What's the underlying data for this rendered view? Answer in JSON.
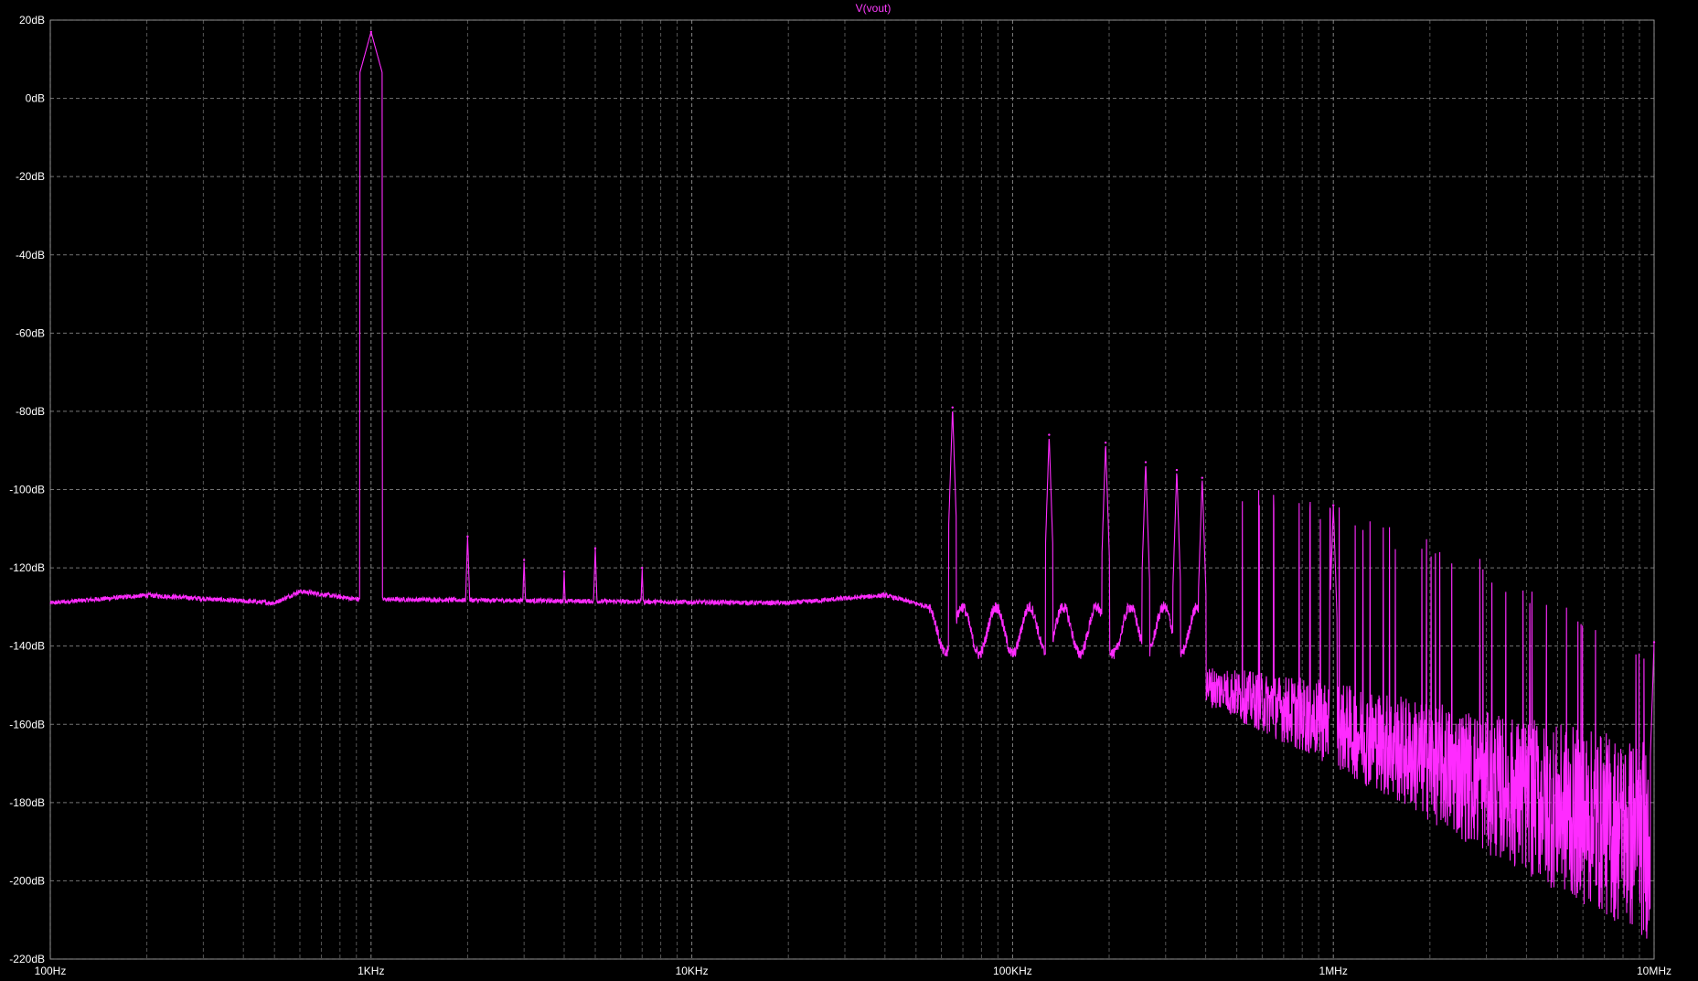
{
  "window": {
    "trace_label": "V(vout)"
  },
  "colors": {
    "background": "#000000",
    "trace": "#ff2bff",
    "grid": "#9a9a9a",
    "text": "#ffffff"
  },
  "chart_data": {
    "type": "line",
    "title": "V(vout)",
    "xlabel": "",
    "ylabel": "",
    "x_scale": "log",
    "xlim": [
      100,
      10000000
    ],
    "ylim": [
      -220,
      20
    ],
    "grid": true,
    "x_ticks": [
      {
        "value": 100,
        "label": "100Hz"
      },
      {
        "value": 1000,
        "label": "1KHz"
      },
      {
        "value": 10000,
        "label": "10KHz"
      },
      {
        "value": 100000,
        "label": "100KHz"
      },
      {
        "value": 1000000,
        "label": "1MHz"
      },
      {
        "value": 10000000,
        "label": "10MHz"
      }
    ],
    "y_ticks": [
      {
        "value": 20,
        "label": "20dB"
      },
      {
        "value": 0,
        "label": "0dB"
      },
      {
        "value": -20,
        "label": "-20dB"
      },
      {
        "value": -40,
        "label": "-40dB"
      },
      {
        "value": -60,
        "label": "-60dB"
      },
      {
        "value": -80,
        "label": "-80dB"
      },
      {
        "value": -100,
        "label": "-100dB"
      },
      {
        "value": -120,
        "label": "-120dB"
      },
      {
        "value": -140,
        "label": "-140dB"
      },
      {
        "value": -160,
        "label": "-160dB"
      },
      {
        "value": -180,
        "label": "-180dB"
      },
      {
        "value": -200,
        "label": "-200dB"
      },
      {
        "value": -220,
        "label": "-220dB"
      }
    ],
    "series": [
      {
        "name": "V(vout)",
        "peaks": [
          {
            "x": 1000,
            "y": 17
          },
          {
            "x": 2000,
            "y": -112
          },
          {
            "x": 3000,
            "y": -118
          },
          {
            "x": 4000,
            "y": -121
          },
          {
            "x": 5000,
            "y": -115
          },
          {
            "x": 7000,
            "y": -120
          },
          {
            "x": 65000,
            "y": -79
          },
          {
            "x": 130000,
            "y": -86
          },
          {
            "x": 195000,
            "y": -88
          },
          {
            "x": 260000,
            "y": -93
          },
          {
            "x": 325000,
            "y": -95
          },
          {
            "x": 390000,
            "y": -97
          },
          {
            "x": 1000000,
            "y": -104
          },
          {
            "x": 10000000,
            "y": -139
          }
        ],
        "noise_floor_low": [
          {
            "x": 100,
            "y": -129
          },
          {
            "x": 200,
            "y": -127
          },
          {
            "x": 500,
            "y": -129
          },
          {
            "x": 600,
            "y": -126
          },
          {
            "x": 900,
            "y": -128
          },
          {
            "x": 20000,
            "y": -129
          },
          {
            "x": 40000,
            "y": -127
          },
          {
            "x": 55000,
            "y": -130
          }
        ],
        "noise_floor_high": [
          {
            "x": 400000,
            "y": -150
          },
          {
            "x": 1000000,
            "y": -160
          },
          {
            "x": 3000000,
            "y": -175
          },
          {
            "x": 10000000,
            "y": -190
          }
        ]
      }
    ]
  }
}
